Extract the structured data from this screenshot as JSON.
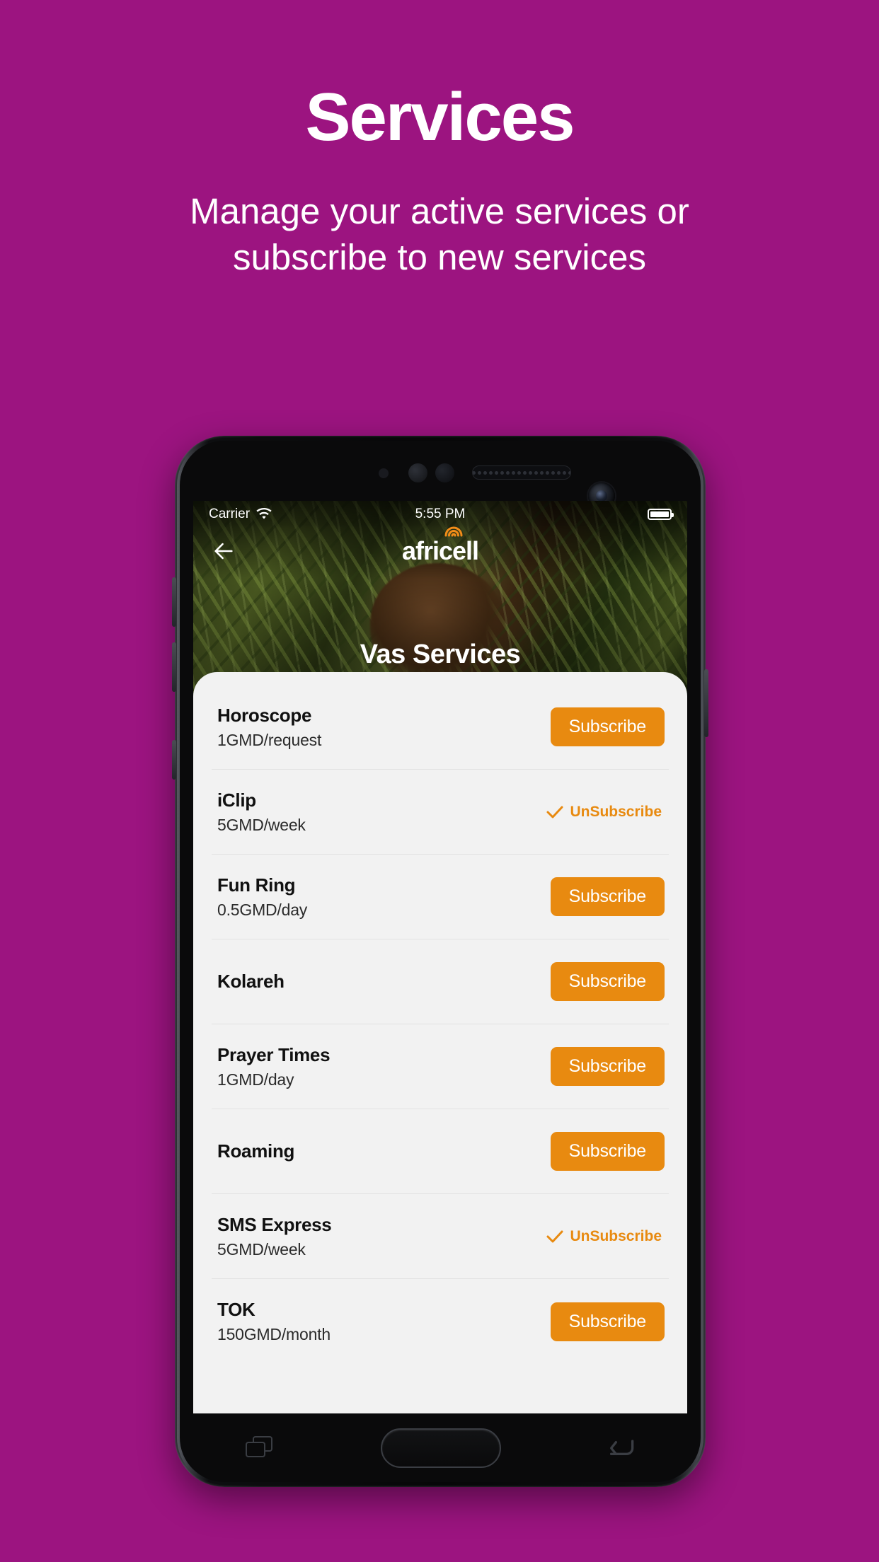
{
  "promo": {
    "title": "Services",
    "subtitle": "Manage your active services or subscribe to new services",
    "background_color": "#9C1480"
  },
  "phone": {
    "status_bar": {
      "carrier": "Carrier",
      "wifi_icon": "wifi-icon",
      "time": "5:55 PM",
      "battery_icon": "battery-full-icon"
    },
    "app_bar": {
      "back_icon": "back-arrow-icon",
      "logo_text": "africell",
      "logo_arcs_icon": "signal-arcs-icon",
      "logo_accent_color": "#F28C18"
    },
    "hero_title": "Vas Services",
    "nav": {
      "recents_icon": "recents-icon",
      "home_icon": "home-button-icon",
      "back_icon": "back-nav-icon"
    }
  },
  "services": {
    "subscribe_label": "Subscribe",
    "unsubscribe_label": "UnSubscribe",
    "accent_color": "#E88A10",
    "items": [
      {
        "name": "Horoscope",
        "price": "1GMD/request",
        "state": "subscribe"
      },
      {
        "name": "iClip",
        "price": "5GMD/week",
        "state": "subscribed"
      },
      {
        "name": "Fun Ring",
        "price": "0.5GMD/day",
        "state": "subscribe"
      },
      {
        "name": "Kolareh",
        "price": "",
        "state": "subscribe"
      },
      {
        "name": "Prayer Times",
        "price": "1GMD/day",
        "state": "subscribe"
      },
      {
        "name": "Roaming",
        "price": "",
        "state": "subscribe"
      },
      {
        "name": "SMS Express",
        "price": "5GMD/week",
        "state": "subscribed"
      },
      {
        "name": "TOK",
        "price": "150GMD/month",
        "state": "subscribe"
      }
    ]
  }
}
